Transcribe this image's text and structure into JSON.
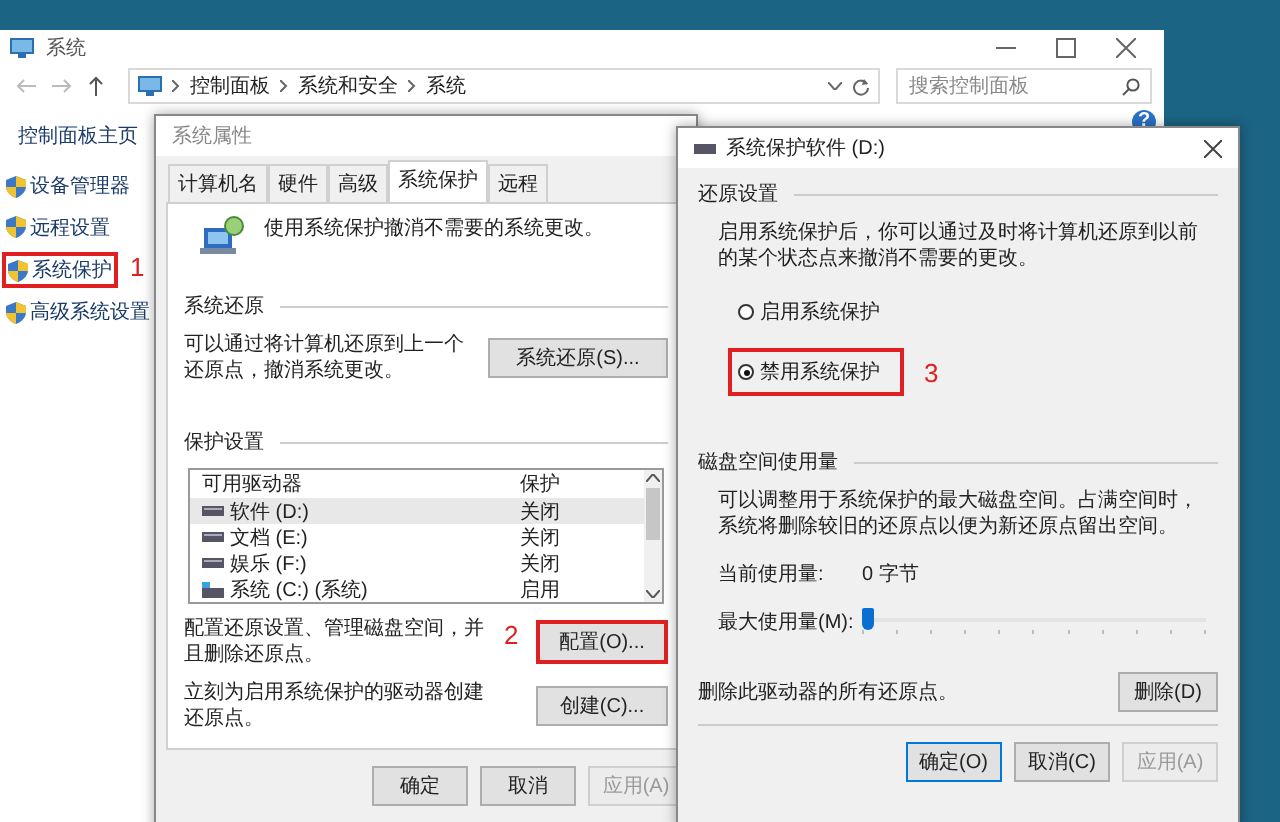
{
  "window": {
    "title": "系统"
  },
  "address_bar": {
    "path": [
      "控制面板",
      "系统和安全",
      "系统"
    ]
  },
  "search": {
    "placeholder": "搜索控制面板"
  },
  "help": "?",
  "sidebar": {
    "home": "控制面板主页",
    "items": [
      {
        "label": "设备管理器"
      },
      {
        "label": "远程设置"
      },
      {
        "label": "系统保护",
        "callout": "1"
      },
      {
        "label": "高级系统设置"
      }
    ]
  },
  "properties_dialog": {
    "title": "系统属性",
    "tabs": [
      {
        "label": "计算机名",
        "selected": false
      },
      {
        "label": "硬件",
        "selected": false
      },
      {
        "label": "高级",
        "selected": false
      },
      {
        "label": "系统保护",
        "selected": true
      },
      {
        "label": "远程",
        "selected": false
      }
    ],
    "intro": "使用系统保护撤消不需要的系统更改。",
    "restore_group": {
      "title": "系统还原",
      "text": "可以通过将计算机还原到上一个还原点，撤消系统更改。",
      "button": "系统还原(S)..."
    },
    "protection_group": {
      "title": "保护设置",
      "columns": [
        "可用驱动器",
        "保护"
      ],
      "drives": [
        {
          "name": "软件 (D:)",
          "protection": "关闭",
          "kind": "disk",
          "selected": true
        },
        {
          "name": "文档 (E:)",
          "protection": "关闭",
          "kind": "disk",
          "selected": false
        },
        {
          "name": "娱乐 (F:)",
          "protection": "关闭",
          "kind": "disk",
          "selected": false
        },
        {
          "name": "系统 (C:) (系统)",
          "protection": "启用",
          "kind": "system",
          "selected": false
        }
      ],
      "configure_text": "配置还原设置、管理磁盘空间，并且删除还原点。",
      "configure_button": {
        "label": "配置(O)...",
        "callout": "2"
      },
      "create_text": "立刻为启用系统保护的驱动器创建还原点。",
      "create_button": "创建(C)..."
    },
    "buttons": [
      {
        "label": "确定",
        "disabled": false
      },
      {
        "label": "取消",
        "disabled": false
      },
      {
        "label": "应用(A)",
        "disabled": true
      }
    ]
  },
  "drive_dialog": {
    "title": "系统保护软件 (D:)",
    "restore_settings": {
      "title": "还原设置",
      "text": "启用系统保护后，你可以通过及时将计算机还原到以前的某个状态点来撤消不需要的更改。",
      "options": [
        {
          "label": "启用系统保护",
          "selected": false
        },
        {
          "label": "禁用系统保护",
          "selected": true,
          "callout": "3"
        }
      ]
    },
    "disk_usage": {
      "title": "磁盘空间使用量",
      "text": "可以调整用于系统保护的最大磁盘空间。占满空间时，系统将删除较旧的还原点以便为新还原点留出空间。",
      "current_label": "当前使用量:",
      "current_value": "0 字节",
      "max_label": "最大使用量(M):",
      "level": 0
    },
    "delete_text": "删除此驱动器的所有还原点。",
    "delete_button": "删除(D)",
    "buttons": [
      {
        "label": "确定(O)",
        "disabled": false,
        "default": true
      },
      {
        "label": "取消(C)",
        "disabled": false,
        "default": false
      },
      {
        "label": "应用(A)",
        "disabled": true,
        "default": false
      }
    ]
  }
}
